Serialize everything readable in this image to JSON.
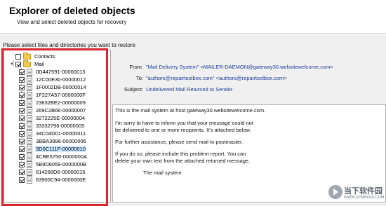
{
  "header": {
    "title": "Explorer of deleted objects",
    "subtitle": "View and select deleted objects for recovery"
  },
  "main": {
    "prompt": "Please select files and directories you want to restore"
  },
  "tree": {
    "contacts": {
      "label": "Contacts",
      "checked": false
    },
    "mail": {
      "label": "Mail",
      "checked": true
    },
    "items": [
      {
        "label": "0D447591-00000013",
        "checked": true,
        "selected": false
      },
      {
        "label": "12C00E30-00000012",
        "checked": true,
        "selected": false
      },
      {
        "label": "1F0002DB-00000014",
        "checked": true,
        "selected": false
      },
      {
        "label": "1F227A57-0000000F",
        "checked": true,
        "selected": false
      },
      {
        "label": "23632BE2-00000009",
        "checked": true,
        "selected": false
      },
      {
        "label": "269C2B66-00000007",
        "checked": true,
        "selected": false
      },
      {
        "label": "3272225E-00000004",
        "checked": true,
        "selected": false
      },
      {
        "label": "33332796-00000005",
        "checked": true,
        "selected": false
      },
      {
        "label": "34C04D01-00000011",
        "checked": true,
        "selected": false
      },
      {
        "label": "3BBA3996-00000006",
        "checked": true,
        "selected": false
      },
      {
        "label": "3D0C111F-00000010",
        "checked": true,
        "selected": true
      },
      {
        "label": "4CBE5750-0000000A",
        "checked": true,
        "selected": false
      },
      {
        "label": "5B9D6059-0000000B",
        "checked": true,
        "selected": false
      },
      {
        "label": "614268D6-00000015",
        "checked": true,
        "selected": false
      },
      {
        "label": "63900C94-0000000E",
        "checked": true,
        "selected": false
      }
    ]
  },
  "message": {
    "from_label": "From:",
    "from_value": "\"Mail Delivery System\" <MAILER-DAEMON@gateway30.websitewelcome.com>",
    "to_label": "To:",
    "to_value": "\"authors@repairtoolbox.com\" <authors@repairtoolbox.com>",
    "subject_label": "Subject:",
    "subject_value": "Undelivered Mail Returned to Sender",
    "body_lines": [
      "This is the mail system at host gateway30.websitewelcome.com.",
      "I'm sorry to have to inform you that your message could not",
      "be delivered to one or more recipients. It's attached below.",
      "For further assistance, please send mail to postmaster.",
      "If you do so, please include this problem report. You can",
      "delete your own text from the attached returned message.",
      "The mail system"
    ]
  },
  "watermark": {
    "brand": "当下软件园",
    "url": "WWW.DOWNXIA.COM"
  },
  "colors": {
    "highlight_border": "#d9252b",
    "link_text": "#1f3c99",
    "selection": "#cde8ff"
  }
}
